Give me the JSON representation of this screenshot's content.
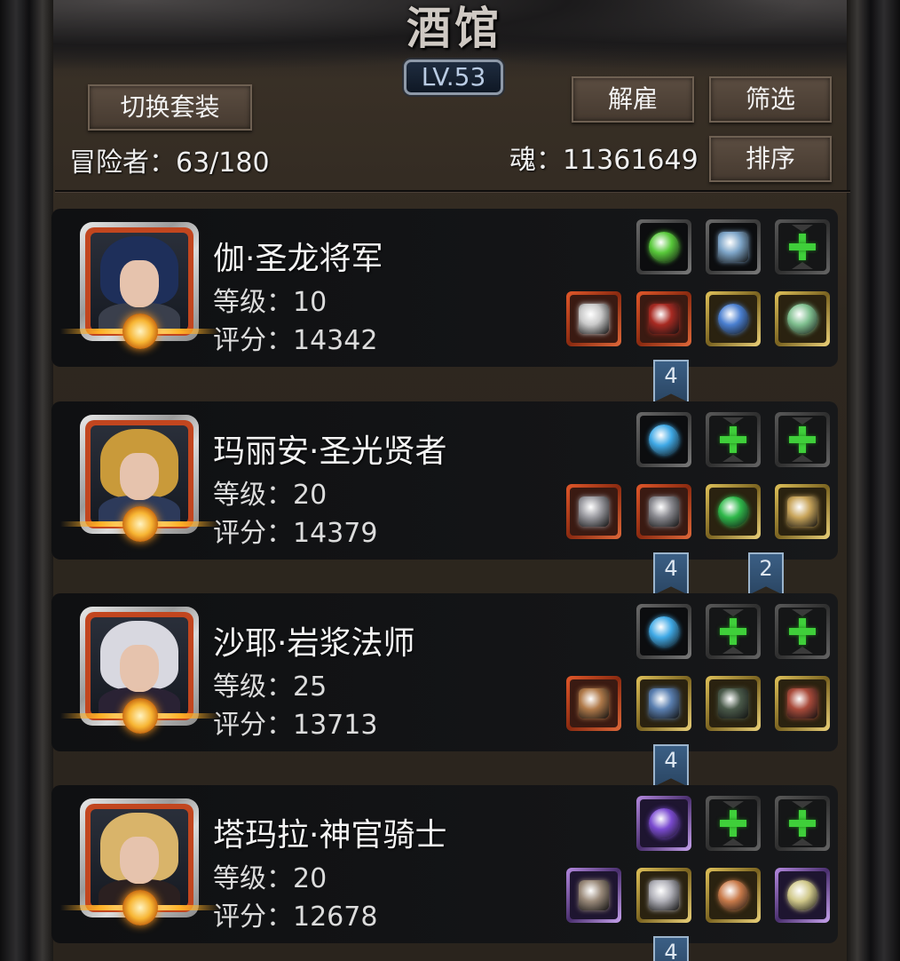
{
  "header": {
    "title": "酒馆",
    "level_badge": "LV.53",
    "switch_outfit_label": "切换套装",
    "dismiss_label": "解雇",
    "filter_label": "筛选",
    "sort_label": "排序",
    "adventurers_text": "冒险者：63/180",
    "soul_text": "魂：11361649"
  },
  "heroes": [
    {
      "name": "伽·圣龙将军",
      "level_text": "等级：10",
      "score_text": "评分：14342",
      "portrait": {
        "hair": "#1e2f5a",
        "body": "#3a3f4c"
      },
      "top_slots": [
        {
          "quality": "gray",
          "icon": "green-crystal-icon",
          "color": "#58c93a"
        },
        {
          "quality": "gray",
          "icon": "blue-book-icon",
          "color": "#7fa6c9"
        },
        {
          "quality": "empty",
          "icon": "add-icon"
        }
      ],
      "bottom_slots": [
        {
          "quality": "orange",
          "icon": "sword-icon",
          "color": "#c9c9c9"
        },
        {
          "quality": "orange",
          "icon": "red-armor-icon",
          "color": "#a82a22"
        },
        {
          "quality": "gold",
          "icon": "necklace-icon",
          "color": "#4a7fd0"
        },
        {
          "quality": "gold",
          "icon": "green-ring-icon",
          "color": "#7fbf8f"
        }
      ],
      "set_flags": [
        "4"
      ]
    },
    {
      "name": "玛丽安·圣光贤者",
      "level_text": "等级：20",
      "score_text": "评分：14379",
      "portrait": {
        "hair": "#c99a3a",
        "body": "#2d3a5a"
      },
      "top_slots": [
        {
          "quality": "gray",
          "icon": "blue-orb-icon",
          "color": "#3fa9e6"
        },
        {
          "quality": "empty",
          "icon": "add-icon"
        },
        {
          "quality": "empty",
          "icon": "add-icon"
        }
      ],
      "bottom_slots": [
        {
          "quality": "orange",
          "icon": "staff-icon",
          "color": "#9a9aa0"
        },
        {
          "quality": "orange",
          "icon": "plate-armor-icon",
          "color": "#8a8a90"
        },
        {
          "quality": "gold",
          "icon": "green-gem-icon",
          "color": "#2fb84a"
        },
        {
          "quality": "gold",
          "icon": "scroll-icon",
          "color": "#c8a45a"
        }
      ],
      "set_flags": [
        "4",
        "2"
      ]
    },
    {
      "name": "沙耶·岩浆法师",
      "level_text": "等级：25",
      "score_text": "评分：13713",
      "portrait": {
        "hair": "#d8d8e0",
        "body": "#2a2234"
      },
      "top_slots": [
        {
          "quality": "gray",
          "icon": "blue-orb-icon",
          "color": "#3fa9e6"
        },
        {
          "quality": "empty",
          "icon": "add-icon"
        },
        {
          "quality": "empty",
          "icon": "add-icon"
        }
      ],
      "bottom_slots": [
        {
          "quality": "orange",
          "icon": "wand-icon",
          "color": "#b07a4a"
        },
        {
          "quality": "gold",
          "icon": "robe-icon",
          "color": "#5a7fb0"
        },
        {
          "quality": "gold",
          "icon": "dark-armor-icon",
          "color": "#4a5a4a"
        },
        {
          "quality": "gold",
          "icon": "red-bracer-icon",
          "color": "#a84a3a"
        }
      ],
      "set_flags": [
        "4"
      ]
    },
    {
      "name": "塔玛拉·神官骑士",
      "level_text": "等级：20",
      "score_text": "评分：12678",
      "portrait": {
        "hair": "#d9b46a",
        "body": "#2b2020"
      },
      "top_slots": [
        {
          "quality": "purple",
          "icon": "purple-crystal-icon",
          "color": "#7a4ad0"
        },
        {
          "quality": "empty",
          "icon": "add-icon"
        },
        {
          "quality": "empty",
          "icon": "add-icon"
        }
      ],
      "bottom_slots": [
        {
          "quality": "purple",
          "icon": "mace-icon",
          "color": "#9a8a7a"
        },
        {
          "quality": "gold",
          "icon": "silver-armor-icon",
          "color": "#b0b0b8"
        },
        {
          "quality": "gold",
          "icon": "bronze-ring-icon",
          "color": "#c87a4a"
        },
        {
          "quality": "purple",
          "icon": "amulet-icon",
          "color": "#d0c88a"
        }
      ],
      "set_flags": [
        "4"
      ]
    }
  ]
}
